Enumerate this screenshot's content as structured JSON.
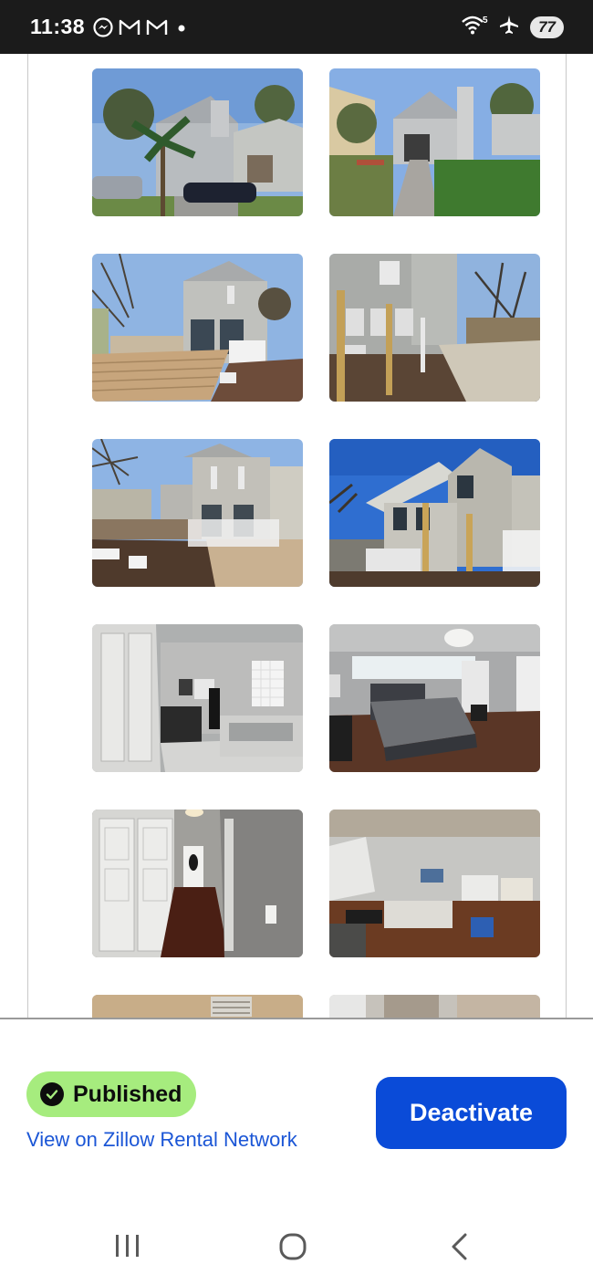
{
  "status_bar": {
    "time": "11:38",
    "notification_icons": [
      "messenger-icon",
      "gmail-icon",
      "gmail-icon",
      "dot-icon"
    ],
    "wifi_label": "5",
    "battery_level": "77"
  },
  "gallery": {
    "photos": [
      {
        "scene": "house-front-palm-cars"
      },
      {
        "scene": "house-front-garage-driveway"
      },
      {
        "scene": "backyard-deck-rear-house"
      },
      {
        "scene": "side-yard-posts"
      },
      {
        "scene": "backyard-deck-wide"
      },
      {
        "scene": "side-house-blue-sky"
      },
      {
        "scene": "bathroom-tub"
      },
      {
        "scene": "bedroom-chandelier"
      },
      {
        "scene": "hallway-wood-floor"
      },
      {
        "scene": "living-room"
      },
      {
        "scene": "room-chandelier-partial"
      },
      {
        "scene": "room-partial"
      }
    ]
  },
  "listing": {
    "status_label": "Published",
    "view_link": "View on Zillow Rental Network",
    "deactivate_label": "Deactivate"
  },
  "colors": {
    "badge_bg": "#a6ec7e",
    "button_bg": "#0a4bd8",
    "link": "#1b56d6"
  },
  "nav": {
    "buttons": [
      "recents-icon",
      "home-icon",
      "back-icon"
    ]
  }
}
